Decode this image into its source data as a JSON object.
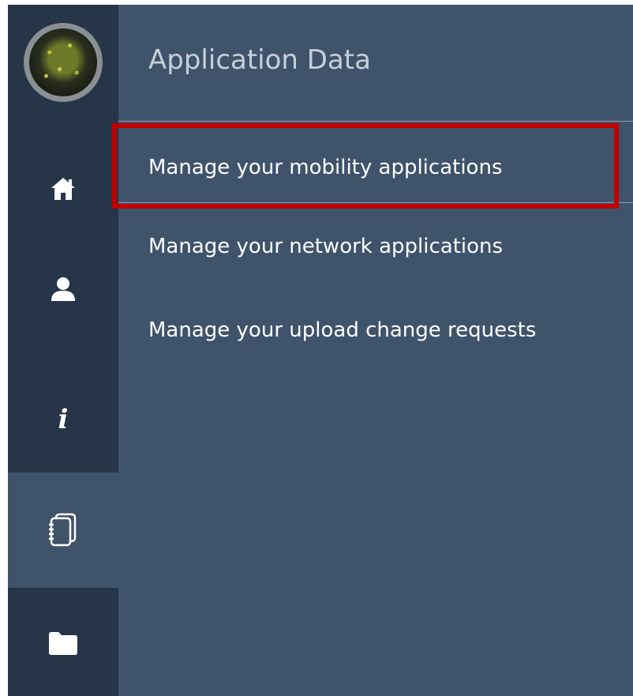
{
  "header": {
    "title": "Application Data"
  },
  "sidebar": {
    "items": [
      {
        "name": "avatar",
        "icon": "avatar-image"
      },
      {
        "name": "home",
        "icon": "home-icon"
      },
      {
        "name": "user",
        "icon": "user-icon"
      },
      {
        "name": "info",
        "icon": "info-icon",
        "glyph": "i"
      },
      {
        "name": "documents",
        "icon": "notebook-icon",
        "active": true
      },
      {
        "name": "folder",
        "icon": "folder-icon"
      }
    ]
  },
  "menu": {
    "items": [
      {
        "label": "Manage your mobility applications",
        "highlighted": true
      },
      {
        "label": "Manage your network applications"
      },
      {
        "label": "Manage your upload change requests"
      }
    ]
  },
  "colors": {
    "rail": "#263548",
    "panel": "#3f536b",
    "highlight": "#c00000",
    "title": "#c6d0da",
    "text": "#ffffff"
  }
}
